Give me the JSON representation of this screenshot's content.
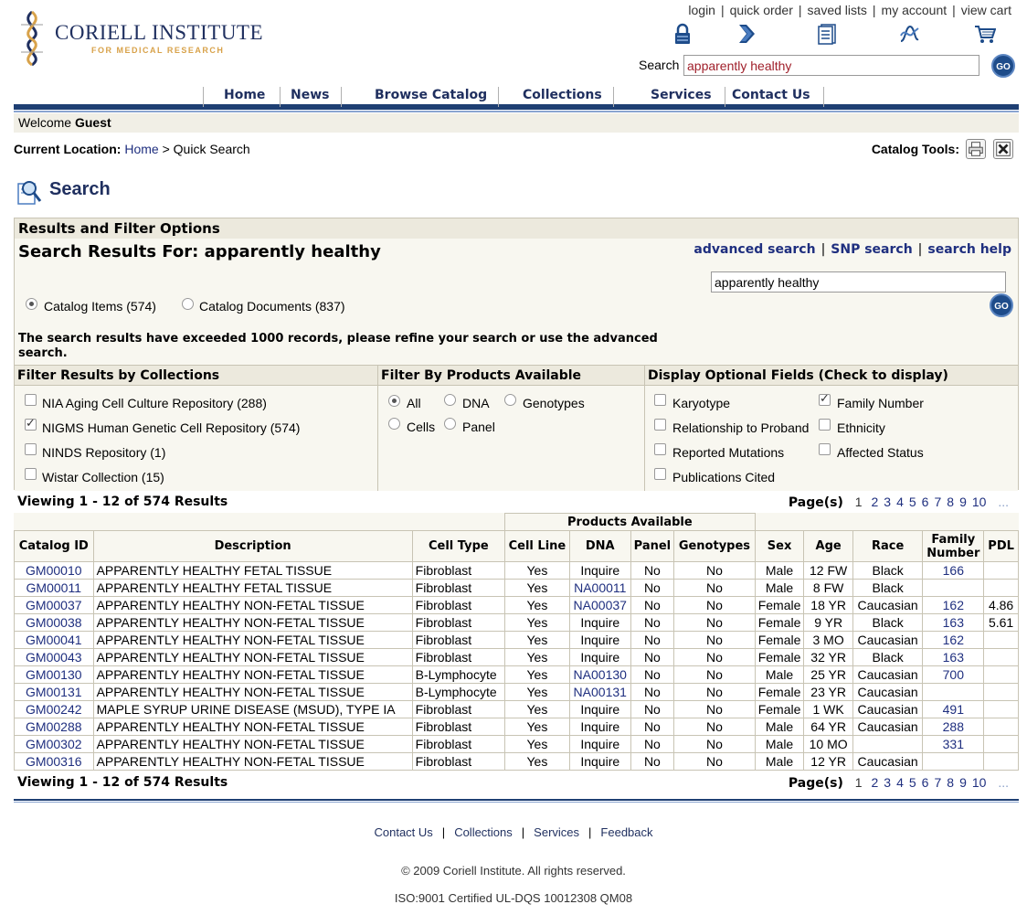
{
  "brand": {
    "name": "Coriell Institute",
    "tagline": "FOR MEDICAL RESEARCH"
  },
  "toplinks": [
    "login",
    "quick order",
    "saved lists",
    "my account",
    "view cart"
  ],
  "header_search": {
    "label": "Search",
    "value": "apparently healthy",
    "go": "GO"
  },
  "nav": [
    "Home",
    "News",
    "Browse Catalog",
    "Collections",
    "Services",
    "Contact Us"
  ],
  "welcome": {
    "prefix": "Welcome",
    "user": "Guest"
  },
  "location": {
    "label": "Current Location:",
    "home": "Home",
    "sep": ">",
    "current": "Quick Search"
  },
  "catalog_tools_label": "Catalog Tools:",
  "page_title": "Search",
  "results_box": {
    "header": "Results and Filter Options",
    "title": "Search Results For: apparently healthy",
    "links": [
      "advanced search",
      "SNP search",
      "search help"
    ],
    "search_value": "apparently healthy",
    "go": "GO",
    "scope": [
      {
        "label": "Catalog Items (574)",
        "selected": true
      },
      {
        "label": "Catalog Documents (837)",
        "selected": false
      }
    ],
    "warning": "The search results have exceeded 1000 records, please refine your search or use the advanced search.",
    "collections": {
      "title": "Filter Results by Collections",
      "items": [
        {
          "label": "NIA Aging Cell Culture Repository (288)",
          "checked": false
        },
        {
          "label": "NIGMS Human Genetic Cell Repository (574)",
          "checked": true
        },
        {
          "label": "NINDS Repository (1)",
          "checked": false
        },
        {
          "label": "Wistar Collection (15)",
          "checked": false
        }
      ]
    },
    "products": {
      "title": "Filter By Products Available",
      "items": [
        {
          "label": "All",
          "selected": true
        },
        {
          "label": "DNA",
          "selected": false
        },
        {
          "label": "Genotypes",
          "selected": false
        },
        {
          "label": "Cells",
          "selected": false
        },
        {
          "label": "Panel",
          "selected": false
        }
      ]
    },
    "optional_fields": {
      "title": "Display Optional Fields (Check to display)",
      "items": [
        {
          "label": "Karyotype",
          "checked": false
        },
        {
          "label": "Family Number",
          "checked": true
        },
        {
          "label": "Relationship to Proband",
          "checked": false
        },
        {
          "label": "Ethnicity",
          "checked": false
        },
        {
          "label": "Reported Mutations",
          "checked": false
        },
        {
          "label": "Affected Status",
          "checked": false
        },
        {
          "label": "Publications Cited",
          "checked": false
        }
      ]
    }
  },
  "viewing": "Viewing 1 - 12 of 574 Results",
  "pagination": {
    "label": "Page(s)",
    "current": "1",
    "pages": [
      "2",
      "3",
      "4",
      "5",
      "6",
      "7",
      "8",
      "9",
      "10"
    ],
    "more": "..."
  },
  "table": {
    "group_header": "Products Available",
    "columns": [
      "Catalog ID",
      "Description",
      "Cell Type",
      "Cell Line",
      "DNA",
      "Panel",
      "Genotypes",
      "Sex",
      "Age",
      "Race",
      "Family Number",
      "PDL"
    ],
    "rows": [
      [
        "GM00010",
        "APPARENTLY HEALTHY FETAL TISSUE",
        "Fibroblast",
        "Yes",
        "Inquire",
        "No",
        "No",
        "Male",
        "12 FW",
        "Black",
        "166",
        ""
      ],
      [
        "GM00011",
        "APPARENTLY HEALTHY FETAL TISSUE",
        "Fibroblast",
        "Yes",
        "NA00011",
        "No",
        "No",
        "Male",
        "8 FW",
        "Black",
        "",
        ""
      ],
      [
        "GM00037",
        "APPARENTLY HEALTHY NON-FETAL TISSUE",
        "Fibroblast",
        "Yes",
        "NA00037",
        "No",
        "No",
        "Female",
        "18 YR",
        "Caucasian",
        "162",
        "4.86"
      ],
      [
        "GM00038",
        "APPARENTLY HEALTHY NON-FETAL TISSUE",
        "Fibroblast",
        "Yes",
        "Inquire",
        "No",
        "No",
        "Female",
        "9 YR",
        "Black",
        "163",
        "5.61"
      ],
      [
        "GM00041",
        "APPARENTLY HEALTHY NON-FETAL TISSUE",
        "Fibroblast",
        "Yes",
        "Inquire",
        "No",
        "No",
        "Female",
        "3 MO",
        "Caucasian",
        "162",
        ""
      ],
      [
        "GM00043",
        "APPARENTLY HEALTHY NON-FETAL TISSUE",
        "Fibroblast",
        "Yes",
        "Inquire",
        "No",
        "No",
        "Female",
        "32 YR",
        "Black",
        "163",
        ""
      ],
      [
        "GM00130",
        "APPARENTLY HEALTHY NON-FETAL TISSUE",
        "B-Lymphocyte",
        "Yes",
        "NA00130",
        "No",
        "No",
        "Male",
        "25 YR",
        "Caucasian",
        "700",
        ""
      ],
      [
        "GM00131",
        "APPARENTLY HEALTHY NON-FETAL TISSUE",
        "B-Lymphocyte",
        "Yes",
        "NA00131",
        "No",
        "No",
        "Female",
        "23 YR",
        "Caucasian",
        "",
        ""
      ],
      [
        "GM00242",
        "MAPLE SYRUP URINE DISEASE (MSUD), TYPE IA",
        "Fibroblast",
        "Yes",
        "Inquire",
        "No",
        "No",
        "Female",
        "1 WK",
        "Caucasian",
        "491",
        ""
      ],
      [
        "GM00288",
        "APPARENTLY HEALTHY NON-FETAL TISSUE",
        "Fibroblast",
        "Yes",
        "Inquire",
        "No",
        "No",
        "Male",
        "64 YR",
        "Caucasian",
        "288",
        ""
      ],
      [
        "GM00302",
        "APPARENTLY HEALTHY NON-FETAL TISSUE",
        "Fibroblast",
        "Yes",
        "Inquire",
        "No",
        "No",
        "Male",
        "10 MO",
        "",
        "331",
        ""
      ],
      [
        "GM00316",
        "APPARENTLY HEALTHY NON-FETAL TISSUE",
        "Fibroblast",
        "Yes",
        "Inquire",
        "No",
        "No",
        "Male",
        "12 YR",
        "Caucasian",
        "",
        ""
      ]
    ]
  },
  "footer": {
    "links": [
      "Contact Us",
      "Collections",
      "Services",
      "Feedback"
    ],
    "copyright": "© 2009 Coriell Institute. All rights reserved.",
    "iso": "ISO:9001 Certified UL-DQS 10012308 QM08"
  },
  "colors": {
    "brand_navy": "#1e3f73",
    "link": "#1f2f7f",
    "panel_bg": "#f8f7f0",
    "header_bg": "#ece9dd",
    "search_text": "#a0202b"
  },
  "icons": [
    "lock-icon",
    "quick-order-arrow-icon",
    "saved-lists-icon",
    "dna-icon",
    "cart-icon",
    "print-icon",
    "excel-icon",
    "search-magnifier-icon"
  ]
}
